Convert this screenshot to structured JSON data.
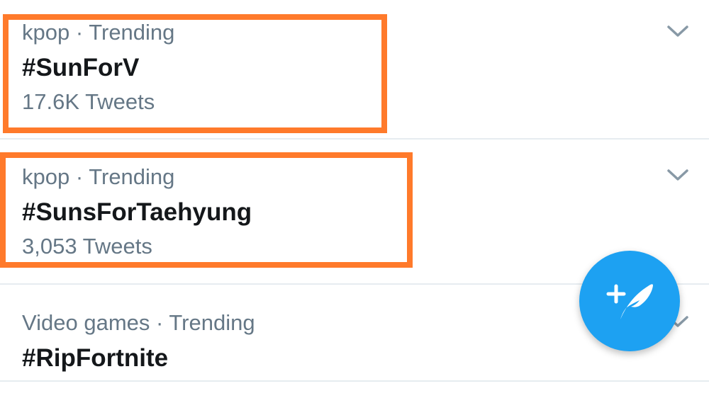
{
  "trends": [
    {
      "context": "kpop · Trending",
      "name": "#SunForV",
      "count": "17.6K Tweets",
      "highlighted": true,
      "menu_icon": "chevron-down-icon"
    },
    {
      "context": "kpop · Trending",
      "name": "#SunsForTaehyung",
      "count": "3,053 Tweets",
      "highlighted": true,
      "menu_icon": "chevron-down-icon"
    },
    {
      "context": "Video games · Trending",
      "name": "#RipFortnite",
      "menu_icon": "chevron-down-icon"
    }
  ],
  "fab": {
    "icon": "compose-tweet-icon",
    "color": "#1da1f2"
  },
  "colors": {
    "highlight": "#ff7a2b",
    "secondary_text": "#657786",
    "primary_text": "#14171a",
    "divider": "#e6ecf0"
  }
}
